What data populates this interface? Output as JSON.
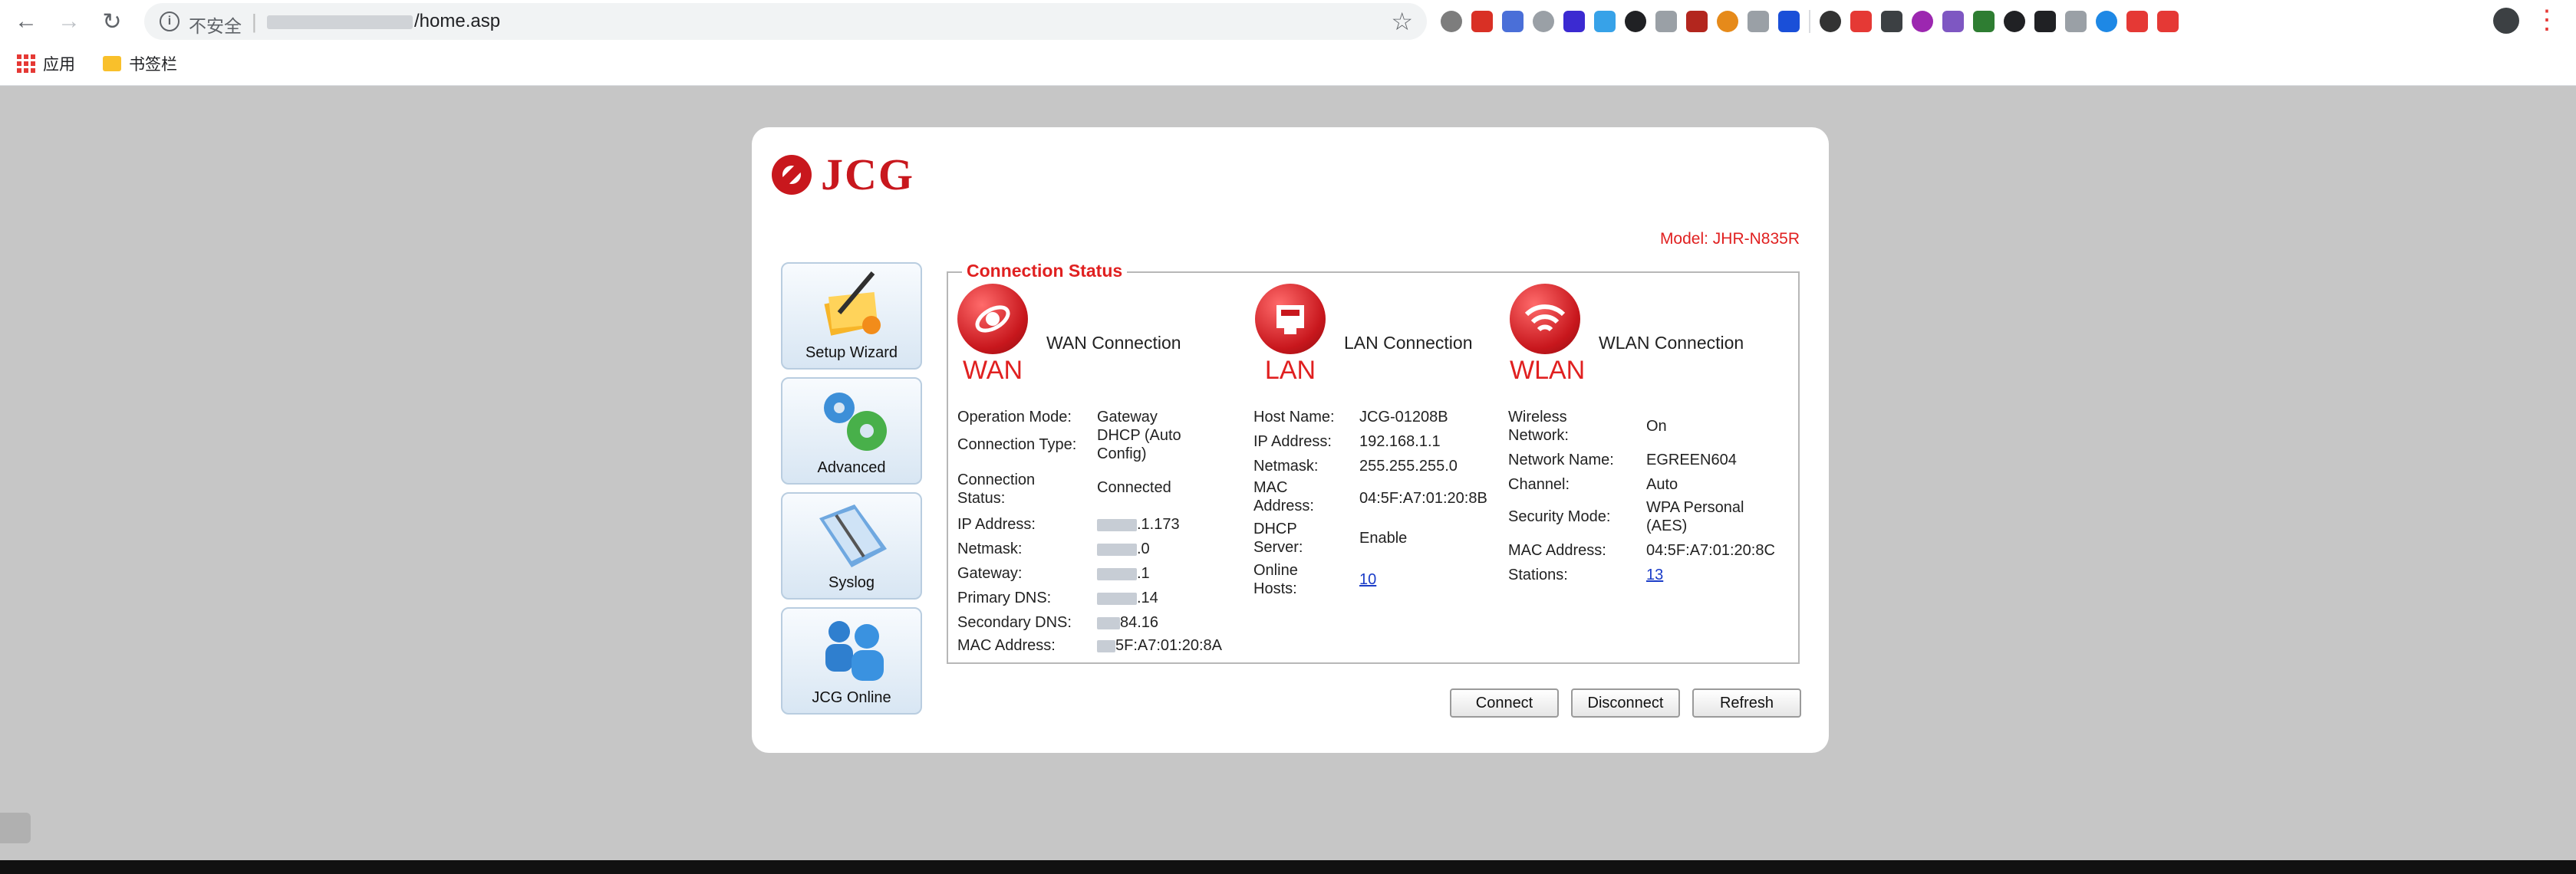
{
  "browser": {
    "security_label": "不安全",
    "url_suffix": "/home.asp",
    "bookmarks": [
      {
        "label": "应用",
        "icon": "apps-grid-icon"
      },
      {
        "label": "书签栏",
        "icon": "folder-icon"
      }
    ],
    "extension_colors": [
      "#7d7d7d",
      "#d93025",
      "#4a6fd8",
      "#9aa0a6",
      "#3b2ad1",
      "#37a2e8",
      "#202124",
      "#9aa0a6",
      "#b3261e",
      "#e68a1a",
      "#9aa0a6",
      "#1a4fd8",
      "#333333",
      "#e53935",
      "#3c4043",
      "#9c27b0",
      "#7e57c2",
      "#2e7d32",
      "#202124",
      "#202124",
      "#9aa0a6",
      "#1e88e5",
      "#e53935",
      "#e53935"
    ]
  },
  "router": {
    "brand": "JCG",
    "model": "Model: JHR-N835R",
    "sidebar": [
      {
        "label": "Setup Wizard",
        "icon": "setup-wizard-icon"
      },
      {
        "label": "Advanced",
        "icon": "advanced-gears-icon"
      },
      {
        "label": "Syslog",
        "icon": "syslog-book-icon"
      },
      {
        "label": "JCG Online",
        "icon": "jcg-online-users-icon"
      }
    ],
    "section_title": "Connection Status",
    "wan": {
      "code": "WAN",
      "title": "WAN Connection",
      "rows": [
        {
          "k": "Operation Mode:",
          "v": "Gateway"
        },
        {
          "k": "Connection Type:",
          "v": "DHCP (Auto Config)"
        },
        {
          "k": "Connection Status:",
          "v": "Connected"
        },
        {
          "k": "IP Address:",
          "v": ".1.173"
        },
        {
          "k": "Netmask:",
          "v": ".0"
        },
        {
          "k": "Gateway:",
          "v": ".1"
        },
        {
          "k": "Primary DNS:",
          "v": ".14"
        },
        {
          "k": "Secondary DNS:",
          "v": "84.16"
        },
        {
          "k": "MAC Address:",
          "v": "5F:A7:01:20:8A"
        }
      ]
    },
    "lan": {
      "code": "LAN",
      "title": "LAN Connection",
      "rows": [
        {
          "k": "Host Name:",
          "v": "JCG-01208B"
        },
        {
          "k": "IP Address:",
          "v": "192.168.1.1"
        },
        {
          "k": "Netmask:",
          "v": "255.255.255.0"
        },
        {
          "k": "MAC Address:",
          "v": "04:5F:A7:01:20:8B"
        },
        {
          "k": "DHCP Server:",
          "v": "Enable"
        },
        {
          "k": "Online Hosts:",
          "v": "10"
        }
      ]
    },
    "wlan": {
      "code": "WLAN",
      "title": "WLAN Connection",
      "rows": [
        {
          "k": "Wireless Network:",
          "v": "On"
        },
        {
          "k": "Network Name:",
          "v": "EGREEN604"
        },
        {
          "k": "Channel:",
          "v": "Auto"
        },
        {
          "k": "Security Mode:",
          "v": "WPA Personal (AES)"
        },
        {
          "k": "MAC Address:",
          "v": "04:5F:A7:01:20:8C"
        },
        {
          "k": "Stations:",
          "v": "13"
        }
      ]
    },
    "buttons": {
      "connect": "Connect",
      "disconnect": "Disconnect",
      "refresh": "Refresh"
    }
  }
}
